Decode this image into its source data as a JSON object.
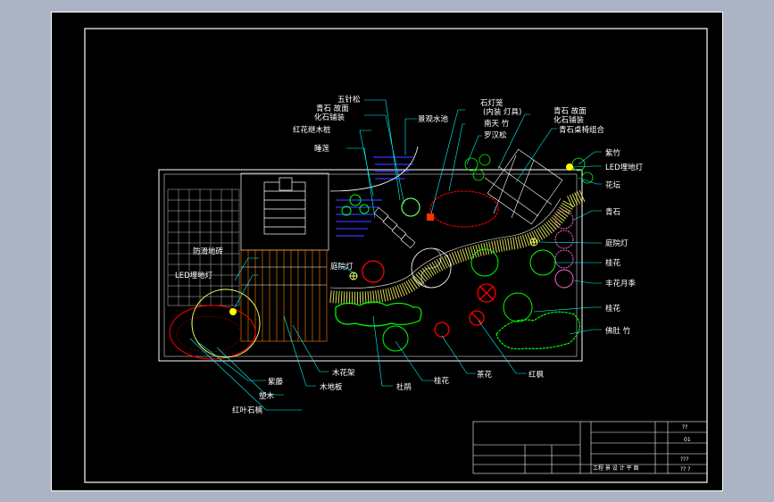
{
  "labels": {
    "wuzhensong": "五针松",
    "qingshi_1": "青石 故面",
    "qingshi_1b": "化石铺装",
    "hongshi_mu": "红花继木桩",
    "shuilian": "睡莲",
    "jingguan": "景观水池",
    "shideng_1": "石灯笼",
    "shideng_2": "(内装 灯具)",
    "nantian": "南天 竹",
    "luohan": "罗汉松",
    "qingshi_2": "青石 故面",
    "qingshi_2b": "化石铺装",
    "qingshi_3": "青石桌椅组合",
    "zizhu": "紫竹",
    "led_1": "LED埋地灯",
    "huatan": "花坛",
    "qingshi_4": "青石",
    "tingyuan_1": "庭院灯",
    "guihua_1": "桂花",
    "fengyue": "丰花月季",
    "guihua_2": "桂花",
    "fudu": "佛肚 竹",
    "fanghua": "防滑地砖",
    "led_2": "LED埋地灯",
    "tingyuan_2": "庭院灯",
    "ziteng": "紫藤",
    "suomu": "塑木",
    "hongye": "红叶石楠",
    "muhuajia": "木花架",
    "mudiban": "木地板",
    "dujuan": "杜鹃",
    "guihua_3": "桂花",
    "chahua": "茶花",
    "hongfeng": "红枫"
  },
  "title_block": {
    "sheet_no": "01",
    "field_a": "??",
    "field_b": "???",
    "drawing_title": "工程 景 设 计 平 面",
    "field_c": "?? ?"
  },
  "colors": {
    "linework": "#ffffff",
    "leader": "#00ffff",
    "pavement": "#ffff66",
    "water": "#3333ff",
    "shrub_green": "#00ff00",
    "red_maple": "#ff0000",
    "rose": "#ff66cc",
    "wood_deck": "#ff8800"
  }
}
